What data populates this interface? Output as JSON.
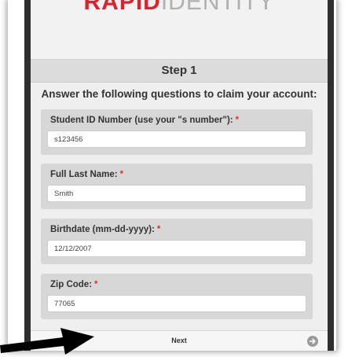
{
  "logo": {
    "part1": "RAPID",
    "part2": "IDENTITY"
  },
  "step": {
    "title": "Step 1"
  },
  "instructions": "Answer the following questions to claim your account:",
  "required_mark": "*",
  "fields": [
    {
      "label": "Student ID Number (use your \"s number\"):",
      "value": "s123456"
    },
    {
      "label": "Full Last Name:",
      "value": "Smith"
    },
    {
      "label": "Birthdate (mm-dd-yyyy):",
      "value": "12/12/2007"
    },
    {
      "label": "Zip Code:",
      "value": "77065"
    }
  ],
  "next_button": {
    "label": "Next",
    "icon": "arrow-right-circle-icon"
  },
  "annotation": {
    "icon": "pointer-arrow-icon",
    "color": "#000000"
  },
  "colors": {
    "brand_red": "#d9232e",
    "required": "#e0303a"
  }
}
